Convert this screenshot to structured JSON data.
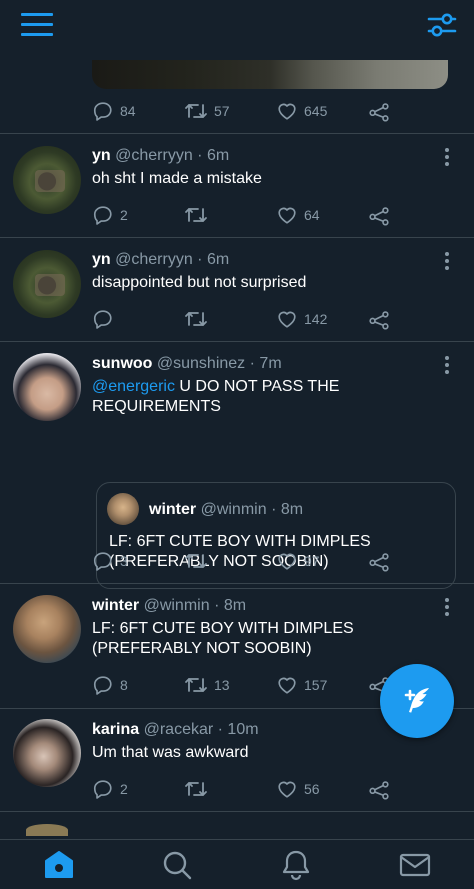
{
  "colors": {
    "background": "#15202b",
    "accent": "#1d9bf0",
    "muted": "#8899a6",
    "divider": "#38444d",
    "text": "#ffffff"
  },
  "top_bar": {
    "menu_icon": "hamburger-menu-icon",
    "filter_icon": "timeline-settings-icon"
  },
  "first_tweet_actions": {
    "replies": "84",
    "retweets": "57",
    "likes": "645"
  },
  "tweets": [
    {
      "name": "yn",
      "handle": "@cherryyn",
      "time": "· 6m",
      "text": "oh sht I made a mistake",
      "replies": "2",
      "retweets": "",
      "likes": "64"
    },
    {
      "name": "yn",
      "handle": "@cherryyn",
      "time": "· 6m",
      "text": "disappointed but not surprised",
      "replies": "",
      "retweets": "",
      "likes": "142"
    },
    {
      "name": "sunwoo",
      "handle": "@sunshinez",
      "time": "· 7m",
      "mention": "@energeric",
      "text": " U DO NOT PASS THE REQUIREMENTS",
      "quote": {
        "name": "winter",
        "handle": "@winmin",
        "time": "· 8m",
        "text": "LF: 6FT CUTE BOY WITH DIMPLES (PREFERABLY NOT SOOBIN)"
      },
      "replies": "3",
      "retweets": "",
      "likes": "97"
    },
    {
      "name": "winter",
      "handle": "@winmin",
      "time": "· 8m",
      "text": "LF: 6FT CUTE BOY WITH DIMPLES (PREFERABLY NOT SOOBIN)",
      "replies": "8",
      "retweets": "13",
      "likes": "157"
    },
    {
      "name": "karina",
      "handle": "@racekar",
      "time": "· 10m",
      "text": "Um that was awkward",
      "replies": "2",
      "retweets": "",
      "likes": "56"
    }
  ],
  "fab": {
    "icon": "compose-tweet-icon"
  },
  "bottom_nav": {
    "items": [
      "home-icon",
      "search-icon",
      "notifications-icon",
      "messages-icon"
    ],
    "active": "home-icon"
  }
}
